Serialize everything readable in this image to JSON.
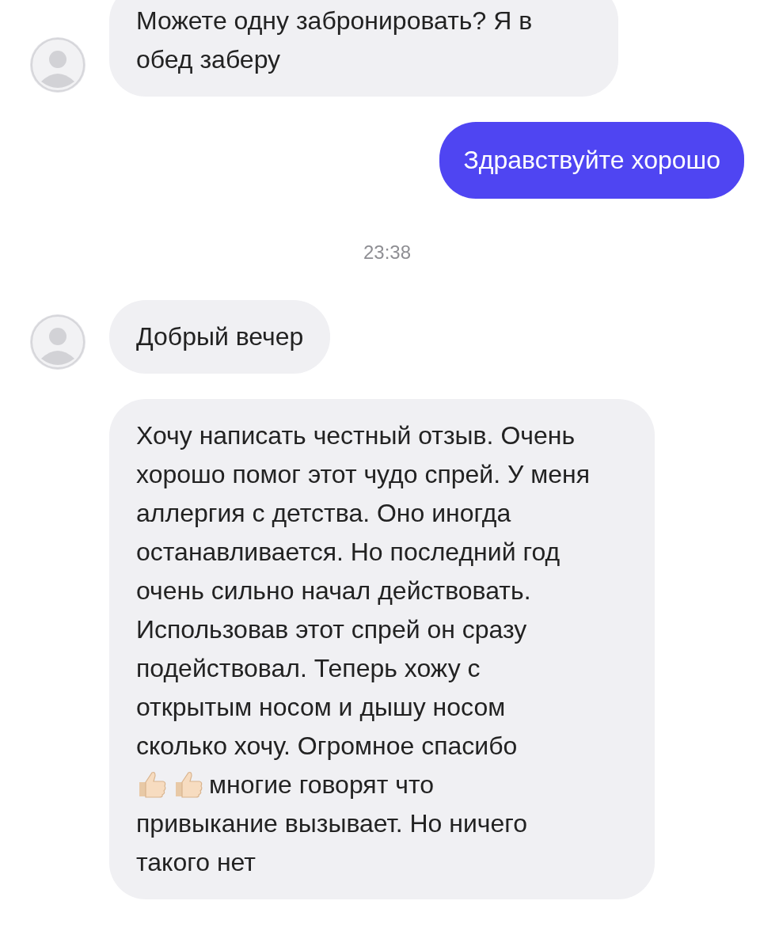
{
  "messages": [
    {
      "kind": "incoming",
      "avatar": true,
      "parts": [
        {
          "kind": "text",
          "text": "Можете одну забронировать? Я в обед заберу"
        }
      ]
    },
    {
      "kind": "outgoing",
      "parts": [
        {
          "kind": "text",
          "text": "Здравствуйте хорошо"
        }
      ]
    },
    {
      "kind": "time",
      "text": "23:38"
    },
    {
      "kind": "incoming",
      "avatar": true,
      "parts": [
        {
          "kind": "text",
          "text": "Добрый вечер"
        }
      ]
    },
    {
      "kind": "incoming",
      "avatar": false,
      "parts": [
        {
          "kind": "text",
          "text": "Хочу написать честный отзыв. Очень хорошо помог этот чудо спрей. У меня аллергия с детства. Оно иногда останавливается. Но последний год очень сильно начал действовать. Использовав этот спрей он сразу подействовал. Теперь хожу с открытым носом и дышу носом сколько хочу. Огромное спасибо"
        },
        {
          "kind": "thumbs_up"
        },
        {
          "kind": "thumbs_up"
        },
        {
          "kind": "inline_text",
          "text": "многие говорят что"
        },
        {
          "kind": "text",
          "text": "привыкание вызывает. Но ничего такого нет"
        }
      ]
    }
  ]
}
